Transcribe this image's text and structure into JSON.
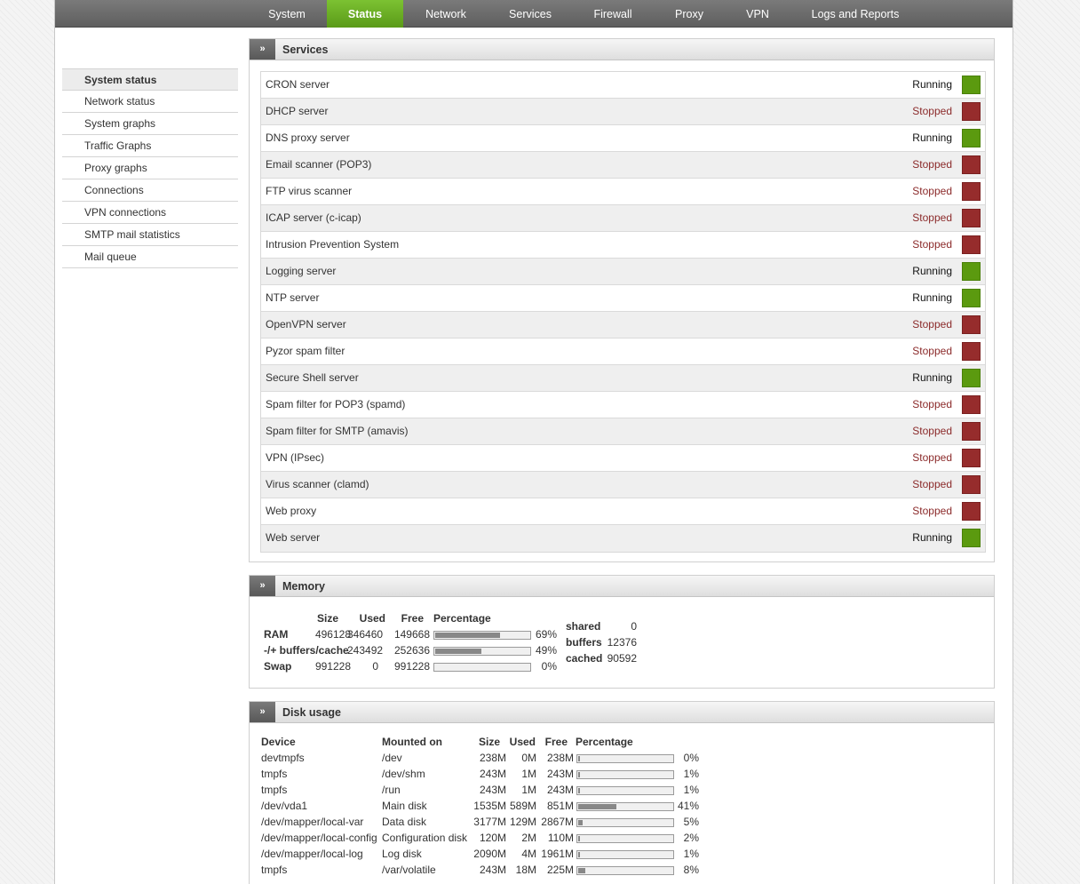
{
  "nav": [
    {
      "label": "System",
      "active": false
    },
    {
      "label": "Status",
      "active": true
    },
    {
      "label": "Network",
      "active": false
    },
    {
      "label": "Services",
      "active": false
    },
    {
      "label": "Firewall",
      "active": false
    },
    {
      "label": "Proxy",
      "active": false
    },
    {
      "label": "VPN",
      "active": false
    },
    {
      "label": "Logs and Reports",
      "active": false
    }
  ],
  "sidebar": [
    {
      "label": "System status",
      "active": true
    },
    {
      "label": "Network status"
    },
    {
      "label": "System graphs"
    },
    {
      "label": "Traffic Graphs"
    },
    {
      "label": "Proxy graphs"
    },
    {
      "label": "Connections"
    },
    {
      "label": "VPN connections"
    },
    {
      "label": "SMTP mail statistics"
    },
    {
      "label": "Mail queue"
    }
  ],
  "toggle_glyph": "»",
  "services": {
    "title": "Services",
    "rows": [
      {
        "name": "CRON server",
        "status": "Running"
      },
      {
        "name": "DHCP server",
        "status": "Stopped"
      },
      {
        "name": "DNS proxy server",
        "status": "Running"
      },
      {
        "name": "Email scanner (POP3)",
        "status": "Stopped"
      },
      {
        "name": "FTP virus scanner",
        "status": "Stopped"
      },
      {
        "name": "ICAP server (c-icap)",
        "status": "Stopped"
      },
      {
        "name": "Intrusion Prevention System",
        "status": "Stopped"
      },
      {
        "name": "Logging server",
        "status": "Running"
      },
      {
        "name": "NTP server",
        "status": "Running"
      },
      {
        "name": "OpenVPN server",
        "status": "Stopped"
      },
      {
        "name": "Pyzor spam filter",
        "status": "Stopped"
      },
      {
        "name": "Secure Shell server",
        "status": "Running"
      },
      {
        "name": "Spam filter for POP3 (spamd)",
        "status": "Stopped"
      },
      {
        "name": "Spam filter for SMTP (amavis)",
        "status": "Stopped"
      },
      {
        "name": "VPN (IPsec)",
        "status": "Stopped"
      },
      {
        "name": "Virus scanner (clamd)",
        "status": "Stopped"
      },
      {
        "name": "Web proxy",
        "status": "Stopped"
      },
      {
        "name": "Web server",
        "status": "Running"
      }
    ]
  },
  "memory": {
    "title": "Memory",
    "headers": {
      "size": "Size",
      "used": "Used",
      "free": "Free",
      "percentage": "Percentage"
    },
    "rows": [
      {
        "label": "RAM",
        "size": "496128",
        "used": "346460",
        "free": "149668",
        "pct": "69%",
        "pct_value": 69
      },
      {
        "label": "-/+ buffers/cache",
        "size": "",
        "used": "243492",
        "free": "252636",
        "pct": "49%",
        "pct_value": 49
      },
      {
        "label": "Swap",
        "size": "991228",
        "used": "0",
        "free": "991228",
        "pct": "0%",
        "pct_value": 0
      }
    ],
    "extra": [
      {
        "label": "shared",
        "value": "0"
      },
      {
        "label": "buffers",
        "value": "12376"
      },
      {
        "label": "cached",
        "value": "90592"
      }
    ]
  },
  "disk": {
    "title": "Disk usage",
    "headers": {
      "device": "Device",
      "mounted": "Mounted on",
      "size": "Size",
      "used": "Used",
      "free": "Free",
      "percentage": "Percentage"
    },
    "rows": [
      {
        "device": "devtmpfs",
        "mounted": "/dev",
        "size": "238M",
        "used": "0M",
        "free": "238M",
        "pct": "0%",
        "pct_value": 0
      },
      {
        "device": "tmpfs",
        "mounted": "/dev/shm",
        "size": "243M",
        "used": "1M",
        "free": "243M",
        "pct": "1%",
        "pct_value": 1
      },
      {
        "device": "tmpfs",
        "mounted": "/run",
        "size": "243M",
        "used": "1M",
        "free": "243M",
        "pct": "1%",
        "pct_value": 1
      },
      {
        "device": "/dev/vda1",
        "mounted": "Main disk",
        "size": "1535M",
        "used": "589M",
        "free": "851M",
        "pct": "41%",
        "pct_value": 41
      },
      {
        "device": "/dev/mapper/local-var",
        "mounted": "Data disk",
        "size": "3177M",
        "used": "129M",
        "free": "2867M",
        "pct": "5%",
        "pct_value": 5
      },
      {
        "device": "/dev/mapper/local-config",
        "mounted": "Configuration disk",
        "size": "120M",
        "used": "2M",
        "free": "110M",
        "pct": "2%",
        "pct_value": 2
      },
      {
        "device": "/dev/mapper/local-log",
        "mounted": "Log disk",
        "size": "2090M",
        "used": "4M",
        "free": "1961M",
        "pct": "1%",
        "pct_value": 1
      },
      {
        "device": "tmpfs",
        "mounted": "/var/volatile",
        "size": "243M",
        "used": "18M",
        "free": "225M",
        "pct": "8%",
        "pct_value": 8
      }
    ]
  }
}
